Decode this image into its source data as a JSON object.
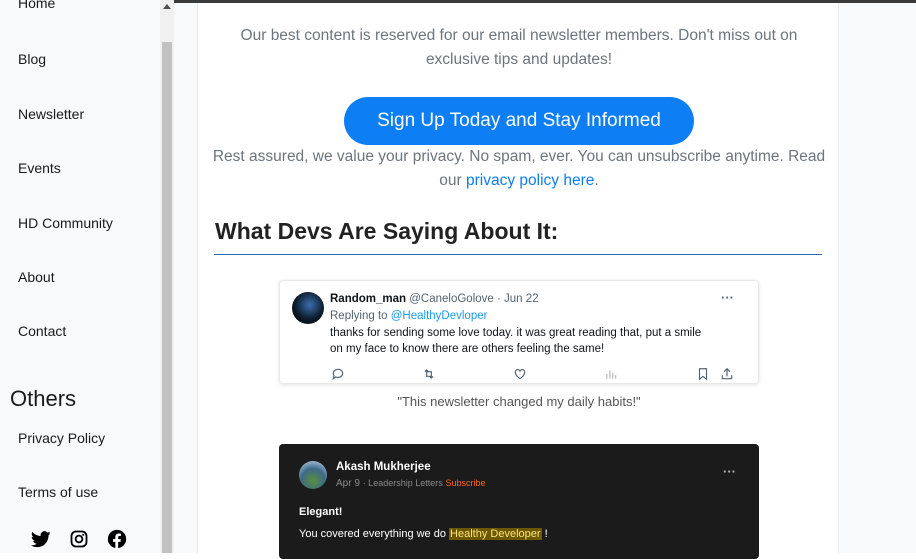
{
  "sidebar": {
    "items": [
      {
        "label": "Home"
      },
      {
        "label": "Blog"
      },
      {
        "label": "Newsletter"
      },
      {
        "label": "Events"
      },
      {
        "label": "HD Community"
      },
      {
        "label": "About"
      },
      {
        "label": "Contact"
      }
    ],
    "others_title": "Others",
    "others_items": [
      {
        "label": "Privacy Policy"
      },
      {
        "label": "Terms of use"
      }
    ],
    "social_icons": [
      "twitter-icon",
      "instagram-icon",
      "facebook-icon"
    ]
  },
  "main": {
    "intro_text": "Our best content is reserved for our email newsletter members. Don't miss out on exclusive tips and updates!",
    "signup_button": "Sign Up Today and Stay Informed",
    "privacy_text_pre": "Rest assured, we value your privacy. No spam, ever. You can unsubscribe anytime. Read our",
    "privacy_link": "privacy policy here",
    "privacy_text_post": ".",
    "section_heading": "What Devs Are Saying About It:",
    "testimonial_1": {
      "name": "Random_man",
      "handle": "@CaneloGolove",
      "date": "· Jun 22",
      "replying_prefix": "Replying to",
      "replying_to": "@HealthyDevloper",
      "body_line_1": "thanks for sending some love today. it was great reading that, put a smile",
      "body_line_2": "on my face to know there are others feeling the same!",
      "more": "···",
      "caption": "\"This newsletter changed my daily habits!\""
    },
    "testimonial_2": {
      "name": "Akash Mukherjee",
      "date": "Apr 9",
      "publication": "· Leadership Letters",
      "subscribe": "Subscribe",
      "title": "Elegant!",
      "body_pre": "You covered everything we do",
      "body_highlight": "Healthy Developer",
      "body_post": "!",
      "more": "···"
    }
  },
  "colors": {
    "accent": "#0d7ef3",
    "link": "#1d9bf0",
    "subscribe": "#ff6719",
    "dark_card": "#1b1b1b"
  }
}
